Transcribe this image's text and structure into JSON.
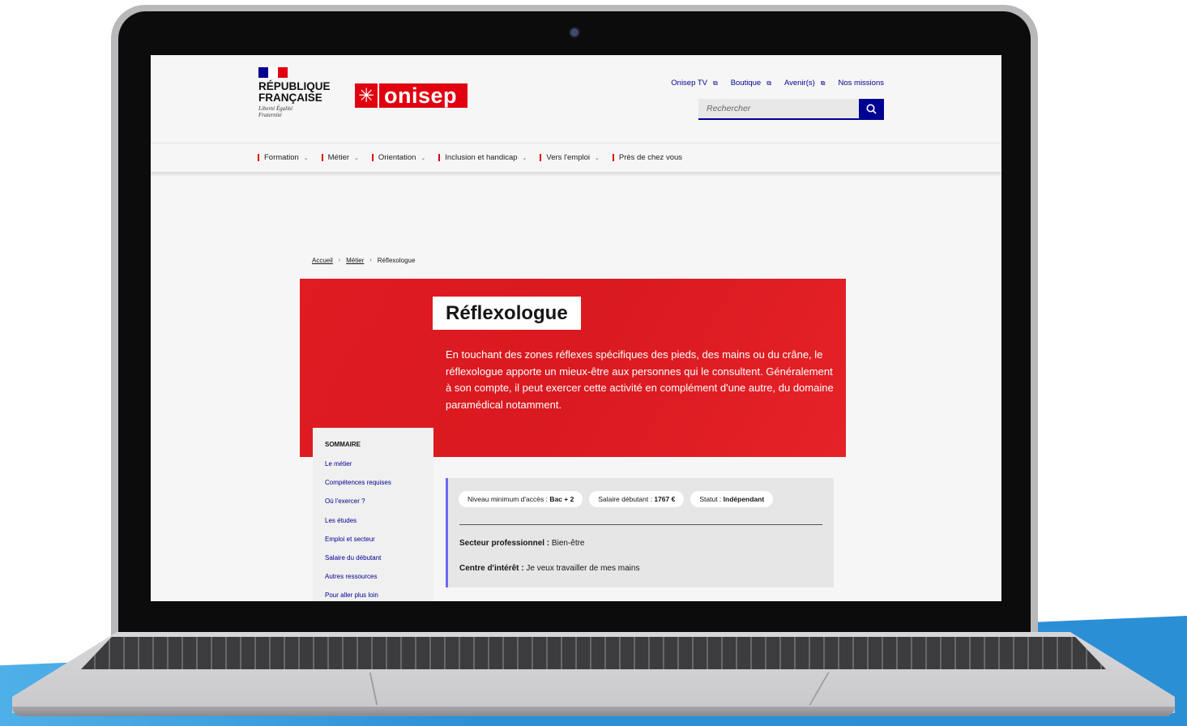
{
  "header": {
    "rf_name": "RÉPUBLIQUE FRANÇAISE",
    "rf_motto": "Liberté Égalité Fraternité",
    "logo_text": "onisep",
    "top_links": [
      {
        "label": "Onisep TV",
        "external": true
      },
      {
        "label": "Boutique",
        "external": true
      },
      {
        "label": "Avenir(s)",
        "external": true
      },
      {
        "label": "Nos missions",
        "external": false
      }
    ],
    "search": {
      "placeholder": "Rechercher"
    }
  },
  "nav": {
    "items": [
      {
        "label": "Formation",
        "has_dropdown": true
      },
      {
        "label": "Métier",
        "has_dropdown": true
      },
      {
        "label": "Orientation",
        "has_dropdown": true
      },
      {
        "label": "Inclusion et handicap",
        "has_dropdown": true
      },
      {
        "label": "Vers l'emploi",
        "has_dropdown": true
      },
      {
        "label": "Près de chez vous",
        "has_dropdown": false
      }
    ]
  },
  "breadcrumb": {
    "items": [
      "Accueil",
      "Métier",
      "Réflexologue"
    ]
  },
  "hero": {
    "title": "Réflexologue",
    "description": "En touchant des zones réflexes spécifiques des pieds, des mains ou du crâne, le réflexologue apporte un mieux-être aux personnes qui le consultent. Généralement à son compte, il peut exercer cette activité en complément d'une autre, du domaine paramédical notamment."
  },
  "sommaire": {
    "title": "SOMMAIRE",
    "items": [
      "Le métier",
      "Compétences requises",
      "Où l'exercer ?",
      "Les études",
      "Emploi et secteur",
      "Salaire du débutant",
      "Autres ressources",
      "Pour aller plus loin"
    ]
  },
  "infobox": {
    "tags": [
      {
        "label": "Niveau minimum d'accès :",
        "value": "Bac + 2"
      },
      {
        "label": "Salaire débutant :",
        "value": "1767 €"
      },
      {
        "label": "Statut :",
        "value": "Indépendant"
      }
    ],
    "secteur_label": "Secteur professionnel :",
    "secteur_value": "Bien-être",
    "interet_label": "Centre d'intérêt :",
    "interet_value": "Je veux travailler de mes mains"
  },
  "colors": {
    "brand_red": "#e1000f",
    "hero_red": "#e01b22",
    "marianne_blue": "#000091",
    "accent_purple": "#6a6af4"
  }
}
